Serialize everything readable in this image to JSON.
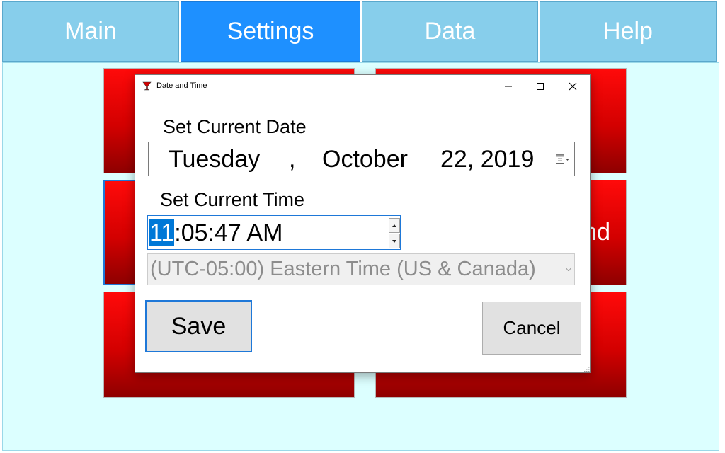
{
  "tabs": [
    {
      "label": "Main"
    },
    {
      "label": "Settings"
    },
    {
      "label": "Data"
    },
    {
      "label": "Help"
    }
  ],
  "active_tab": "Settings",
  "background_buttons": {
    "partial_label": "nd"
  },
  "dialog": {
    "title": "Date and Time",
    "date_label": "Set Current Date",
    "date": {
      "weekday": "Tuesday",
      "separator": ",",
      "month": "October",
      "day_year": "22, 2019"
    },
    "time_label": "Set Current Time",
    "time": {
      "hour": "11",
      "rest": ":05:47 AM"
    },
    "timezone": "(UTC-05:00) Eastern Time (US & Canada)",
    "save_label": "Save",
    "cancel_label": "Cancel"
  },
  "colors": {
    "tab_inactive": "#87ceeb",
    "tab_active": "#1e90ff",
    "content_bg": "#dcffff",
    "button_red": "#e00000",
    "focus_blue": "#1e78d8"
  },
  "icons": [
    "app-glass-icon",
    "minimize-icon",
    "maximize-icon",
    "close-icon",
    "calendar-dropdown-icon",
    "spin-up-icon",
    "spin-down-icon",
    "dropdown-arrow-icon",
    "resize-grip-icon"
  ]
}
